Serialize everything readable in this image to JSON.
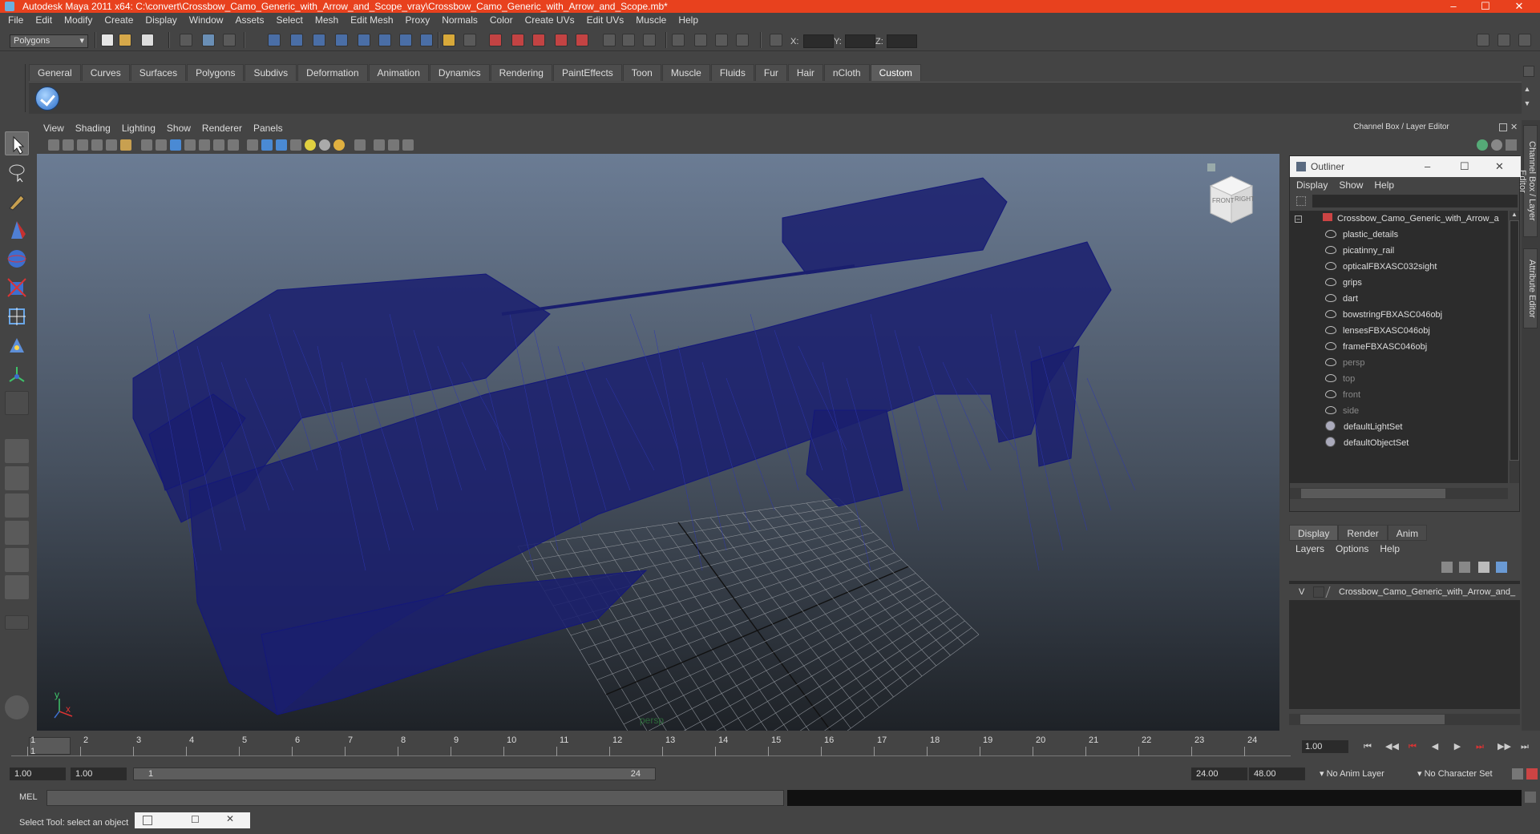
{
  "window": {
    "title": "Autodesk Maya 2011 x64: C:\\convert\\Crossbow_Camo_Generic_with_Arrow_and_Scope_vray\\Crossbow_Camo_Generic_with_Arrow_and_Scope.mb*"
  },
  "menubar": [
    "File",
    "Edit",
    "Modify",
    "Create",
    "Display",
    "Window",
    "Assets",
    "Select",
    "Mesh",
    "Edit Mesh",
    "Proxy",
    "Normals",
    "Color",
    "Create UVs",
    "Edit UVs",
    "Muscle",
    "Help"
  ],
  "statusline": {
    "mode": "Polygons",
    "x_label": "X:",
    "y_label": "Y:",
    "z_label": "Z:"
  },
  "shelf": {
    "tabs": [
      "General",
      "Curves",
      "Surfaces",
      "Polygons",
      "Subdivs",
      "Deformation",
      "Animation",
      "Dynamics",
      "Rendering",
      "PaintEffects",
      "Toon",
      "Muscle",
      "Fluids",
      "Fur",
      "Hair",
      "nCloth",
      "Custom"
    ],
    "active": "Custom"
  },
  "viewport": {
    "menu": [
      "View",
      "Shading",
      "Lighting",
      "Show",
      "Renderer",
      "Panels"
    ],
    "camera": "persp",
    "cube_front": "FRONT",
    "cube_right": "RIGHT",
    "axis_y": "y",
    "axis_x": "x"
  },
  "channelbox": {
    "title": "Channel Box / Layer Editor"
  },
  "outliner": {
    "title": "Outliner",
    "menu": [
      "Display",
      "Show",
      "Help"
    ],
    "root": "Crossbow_Camo_Generic_with_Arrow_a",
    "children": [
      "plastic_details",
      "picatinny_rail",
      "opticalFBXASC032sight",
      "grips",
      "dart",
      "bowstringFBXASC046obj",
      "lensesFBXASC046obj",
      "frameFBXASC046obj"
    ],
    "cameras": [
      "persp",
      "top",
      "front",
      "side"
    ],
    "sets": [
      "defaultLightSet",
      "defaultObjectSet"
    ]
  },
  "layereditor": {
    "tabs": [
      "Display",
      "Render",
      "Anim"
    ],
    "active": "Display",
    "menu": [
      "Layers",
      "Options",
      "Help"
    ],
    "layer_visible": "V",
    "layer_name": "Crossbow_Camo_Generic_with_Arrow_and_"
  },
  "sidetabs": [
    "Channel Box / Layer Editor",
    "Attribute Editor"
  ],
  "timeline": {
    "ticks": [
      "1",
      "2",
      "3",
      "4",
      "5",
      "6",
      "7",
      "8",
      "9",
      "10",
      "11",
      "12",
      "13",
      "14",
      "15",
      "16",
      "17",
      "18",
      "19",
      "20",
      "21",
      "22",
      "23",
      "24"
    ],
    "current_marker": "1",
    "current_time": "1.00"
  },
  "range": {
    "start": "1.00",
    "playback_start": "1.00",
    "slider_start": "1",
    "slider_end": "24",
    "playback_end": "24.00",
    "end": "48.00",
    "anim_layer": "No Anim Layer",
    "character_set": "No Character Set"
  },
  "cmdline": {
    "label": "MEL"
  },
  "helpline": {
    "text": "Select Tool: select an object"
  }
}
